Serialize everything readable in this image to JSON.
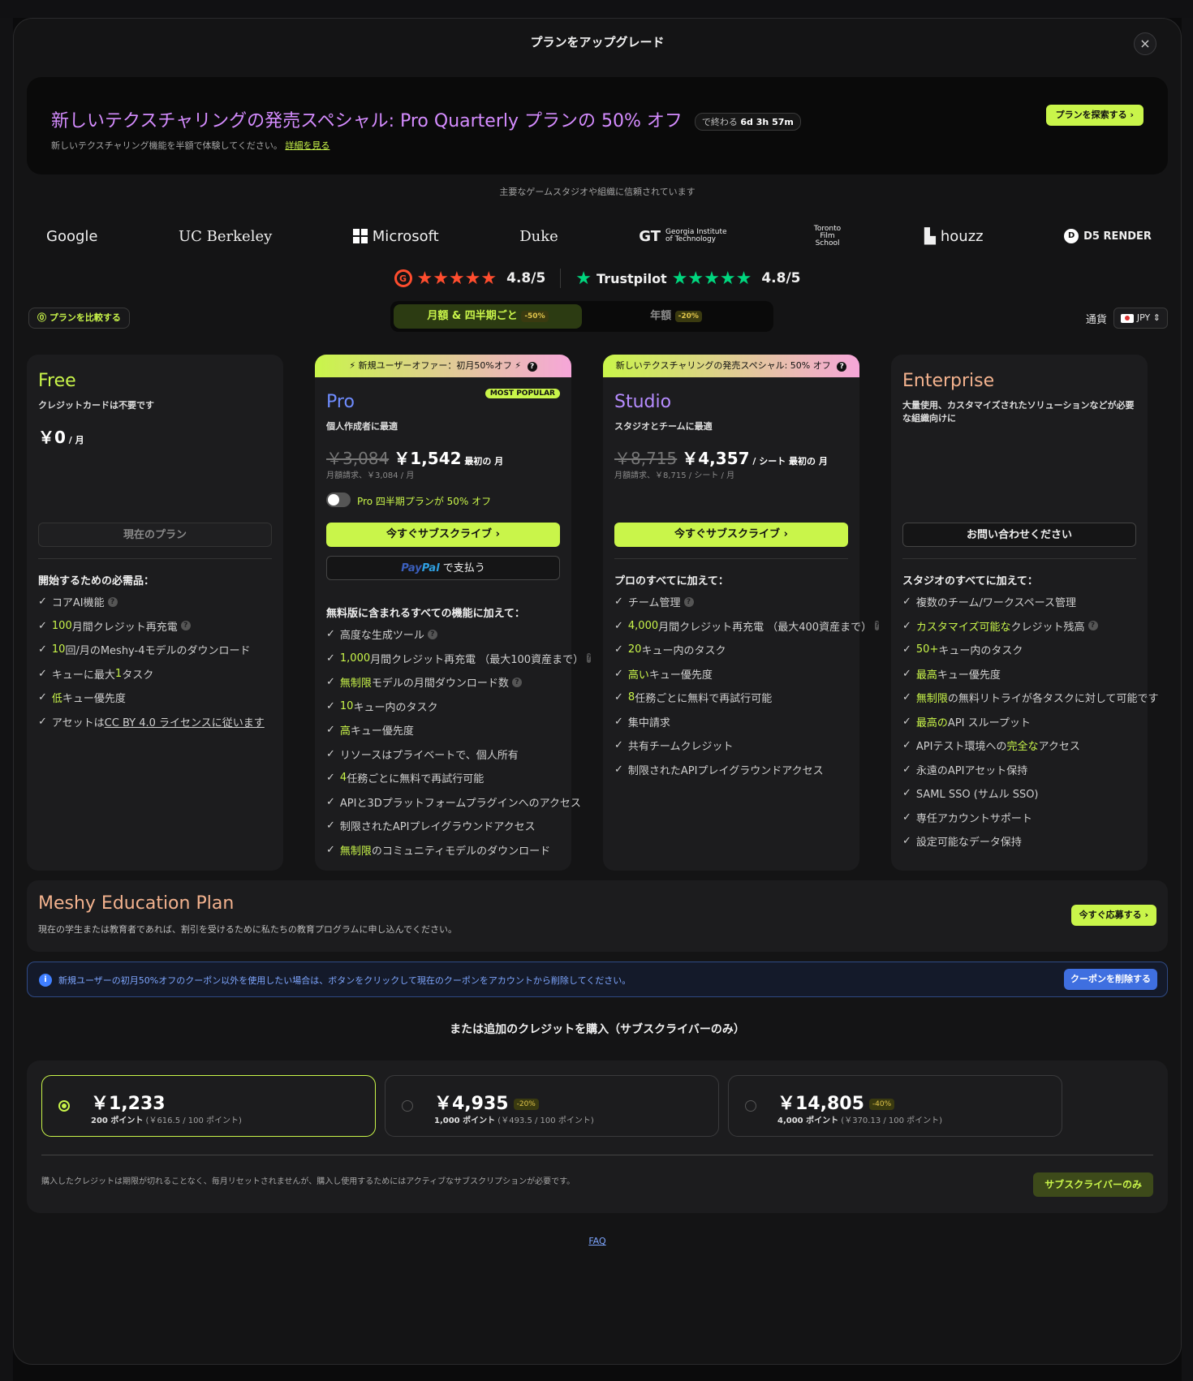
{
  "modal": {
    "title": "プランをアップグレード",
    "close": "×"
  },
  "promo": {
    "title": "新しいテクスチャリングの発売スペシャル: Pro Quarterly プランの 50% オフ",
    "timer_prefix": "で終わる",
    "timer_value": "6d 3h 57m",
    "subtitle": "新しいテクスチャリング機能を半額で体験してください。",
    "link": "詳細を見る",
    "button": "プランを探索する ›"
  },
  "trusted": {
    "text": "主要なゲームスタジオや組織に信頼されています",
    "logos": [
      "Google",
      "UC Berkeley",
      "Microsoft",
      "Duke",
      "Georgia Institute of Technology",
      "Toronto Film School",
      "houzz",
      "D5 RENDER"
    ]
  },
  "ratings": {
    "g2": {
      "icon": "G",
      "stars": "★★★★★",
      "value": "4.8/5"
    },
    "trustpilot": {
      "name": "Trustpilot",
      "stars": "★★★★★",
      "value": "4.8/5"
    }
  },
  "compare_button": "⓪ プランを比較する",
  "billing": {
    "monthly": "月額 & 四半期ごと",
    "monthly_badge": "-50%",
    "yearly": "年額",
    "yearly_badge": "-20%"
  },
  "currency": {
    "label": "通貨",
    "value": "JPY"
  },
  "plans": {
    "free": {
      "name": "Free",
      "desc": "クレジットカードは不要です",
      "price": "￥0",
      "unit": " / 月",
      "cta": "現在のプラン",
      "feat_title": "開始するための必需品：",
      "features": [
        {
          "pre": "",
          "hl": "",
          "post": "コアAI機能"
        },
        {
          "pre": "",
          "hl": "100",
          "post": " 月間クレジット再充電"
        },
        {
          "pre": "",
          "hl": "10",
          "post": "回/月のMeshy-4モデルのダウンロード"
        },
        {
          "pre": "キューに最大 ",
          "hl": "1",
          "post": " タスク"
        },
        {
          "pre": "",
          "hl": "低",
          "post": " キュー優先度"
        },
        {
          "pre": "アセットは ",
          "hl": "",
          "post": "CC BY 4.0 ライセンスに従います"
        }
      ]
    },
    "pro": {
      "banner": "⚡ 新規ユーザーオファー：初月50%オフ ⚡",
      "badge": "MOST POPULAR",
      "name": "Pro",
      "desc": "個人作成者に最適",
      "old_price": "￥3,084",
      "price": "￥1,542",
      "unit": " 最初の 月",
      "bill": "月額請求、￥3,084 / 月",
      "toggle_label": "Pro 四半期プランが 50% オフ",
      "cta": "今すぐサブスクライブ ›",
      "paypal_a": "Pay",
      "paypal_b": "Pal",
      "paypal_c": " で支払う",
      "feat_title": "無料版に含まれるすべての機能に加えて：",
      "features": [
        {
          "pre": "",
          "hl": "",
          "post": "高度な生成ツール"
        },
        {
          "pre": "",
          "hl": "1,000",
          "post": " 月間クレジット再充電 （最大100資産まで）"
        },
        {
          "pre": "",
          "hl": "無制限",
          "post": " モデルの月間ダウンロード数"
        },
        {
          "pre": "",
          "hl": "10",
          "post": "キュー内のタスク"
        },
        {
          "pre": "",
          "hl": "高",
          "post": " キュー優先度"
        },
        {
          "pre": "",
          "hl": "",
          "post": "リソースはプライベートで、個人所有"
        },
        {
          "pre": "",
          "hl": "4",
          "post": " 任務ごとに無料で再試行可能"
        },
        {
          "pre": "",
          "hl": "",
          "post": "APIと3Dプラットフォームプラグインへのアクセス"
        },
        {
          "pre": "",
          "hl": "",
          "post": "制限されたAPIプレイグラウンドアクセス"
        },
        {
          "pre": "",
          "hl": "無制限",
          "post": " のコミュニティモデルのダウンロード"
        }
      ]
    },
    "studio": {
      "banner": "新しいテクスチャリングの発売スペシャル: 50% オフ",
      "name": "Studio",
      "desc": "スタジオとチームに最適",
      "old_price": "￥8,715",
      "price": "￥4,357",
      "unit": " / シート 最初の 月",
      "bill": "月額請求、￥8,715 / シート / 月",
      "cta": "今すぐサブスクライブ ›",
      "feat_title": "プロのすべてに加えて：",
      "features": [
        {
          "pre": "",
          "hl": "",
          "post": "チーム管理"
        },
        {
          "pre": "",
          "hl": "4,000",
          "post": " 月間クレジット再充電 （最大400資産まで）"
        },
        {
          "pre": "",
          "hl": "20",
          "post": "キュー内のタスク"
        },
        {
          "pre": "",
          "hl": "高い",
          "post": " キュー優先度"
        },
        {
          "pre": "",
          "hl": "8",
          "post": " 任務ごとに無料で再試行可能"
        },
        {
          "pre": "",
          "hl": "",
          "post": "集中請求"
        },
        {
          "pre": "",
          "hl": "",
          "post": "共有チームクレジット"
        },
        {
          "pre": "",
          "hl": "",
          "post": "制限されたAPIプレイグラウンドアクセス"
        }
      ]
    },
    "enterprise": {
      "name": "Enterprise",
      "desc": "大量使用、カスタマイズされたソリューションなどが必要な組織向けに",
      "cta": "お問い合わせください",
      "feat_title": "スタジオのすべてに加えて：",
      "features": [
        {
          "pre": "",
          "hl": "",
          "post": "複数のチーム/ワークスペース管理"
        },
        {
          "pre": "",
          "hl": "カスタマイズ可能な",
          "post": " クレジット残高"
        },
        {
          "pre": "",
          "hl": "50+",
          "post": "キュー内のタスク"
        },
        {
          "pre": "",
          "hl": "最高",
          "post": " キュー優先度"
        },
        {
          "pre": "",
          "hl": "無制限",
          "post": "の無料リトライが各タスクに対して可能です"
        },
        {
          "pre": "",
          "hl": "最高の",
          "post": " API スループット"
        },
        {
          "pre": "APIテスト環境への",
          "hl": "完全な",
          "post": "アクセス"
        },
        {
          "pre": "",
          "hl": "",
          "post": "永遠のAPIアセット保持"
        },
        {
          "pre": "",
          "hl": "",
          "post": "SAML SSO (サムル SSO)"
        },
        {
          "pre": "",
          "hl": "",
          "post": "専任アカウントサポート"
        },
        {
          "pre": "",
          "hl": "",
          "post": "設定可能なデータ保持"
        }
      ]
    }
  },
  "education": {
    "title": "Meshy Education Plan",
    "subtitle": "現在の学生または教育者であれば、割引を受けるために私たちの教育プログラムに申し込んでください。",
    "button": "今すぐ応募する ›"
  },
  "notice": {
    "text": "新規ユーザーの初月50%オフのクーポン以外を使用したい場合は、ボタンをクリックして現在のクーポンをアカウントから削除してください。",
    "button": "クーポンを削除する"
  },
  "credits": {
    "title": "または追加のクレジットを購入（サブスクライバーのみ）",
    "options": [
      {
        "price": "￥1,233",
        "badge": "",
        "points": "200 ポイント",
        "rate": " (￥616.5 / 100 ポイント)",
        "selected": true
      },
      {
        "price": "￥4,935",
        "badge": "-20%",
        "points": "1,000 ポイント",
        "rate": " (￥493.5 / 100 ポイント)",
        "selected": false
      },
      {
        "price": "￥14,805",
        "badge": "-40%",
        "points": "4,000 ポイント",
        "rate": " (￥370.13 / 100 ポイント)",
        "selected": false
      }
    ],
    "note": "購入したクレジットは期限が切れることなく、毎月リセットされませんが、購入し使用するためにはアクティブなサブスクリプションが必要です。",
    "button": "サブスクライバーのみ"
  },
  "faq": "FAQ",
  "colors": {
    "accent": "#c9f54a",
    "pro": "#6f8cff",
    "studio": "#b68cff",
    "enterprise": "#f3b28e",
    "promo": "#d58cff"
  }
}
